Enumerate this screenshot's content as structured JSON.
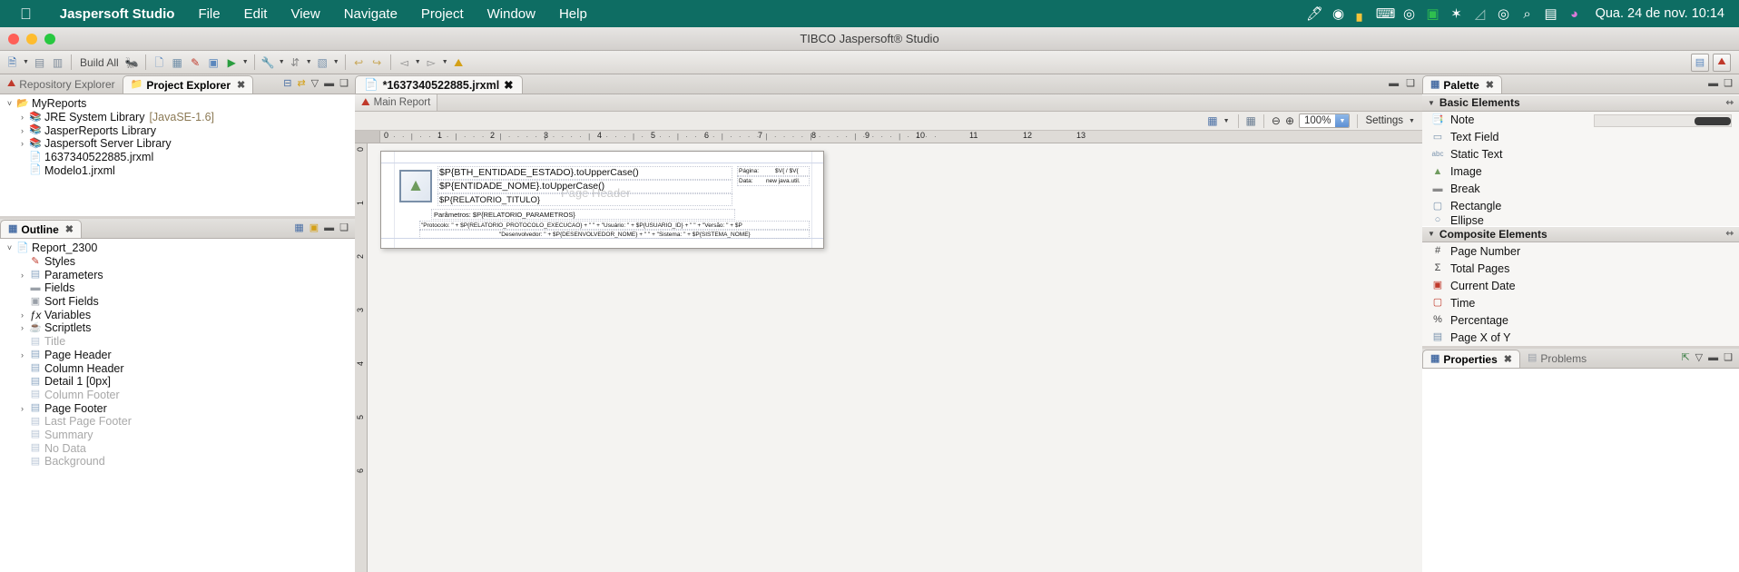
{
  "macmenu": {
    "apple": "",
    "items": [
      {
        "label": "Jaspersoft Studio",
        "bold": true
      },
      {
        "label": "File",
        "bold": false
      },
      {
        "label": "Edit",
        "bold": false
      },
      {
        "label": "View",
        "bold": false
      },
      {
        "label": "Navigate",
        "bold": false
      },
      {
        "label": "Project",
        "bold": false
      },
      {
        "label": "Window",
        "bold": false
      },
      {
        "label": "Help",
        "bold": false
      }
    ],
    "status_icons": [
      {
        "name": "feather-icon",
        "glyph": "🖋"
      },
      {
        "name": "dropbox-icon",
        "glyph": "◍"
      },
      {
        "name": "shield-yellow-icon",
        "glyph": "⬒"
      },
      {
        "name": "keyboard-icon",
        "glyph": "⌨"
      },
      {
        "name": "play-circle-icon",
        "glyph": "◉"
      },
      {
        "name": "brazil-flag-icon",
        "glyph": "▣"
      },
      {
        "name": "bluetooth-icon",
        "glyph": "✦"
      },
      {
        "name": "wifi-off-icon",
        "glyph": "◺"
      },
      {
        "name": "user-account-icon",
        "glyph": "◉"
      },
      {
        "name": "search-icon",
        "glyph": "⌕"
      },
      {
        "name": "display-icon",
        "glyph": "▤"
      },
      {
        "name": "siri-icon",
        "glyph": "◕"
      }
    ],
    "clock": "Qua. 24 de nov.  10:14"
  },
  "window": {
    "title": "TIBCO Jaspersoft® Studio"
  },
  "toolbar": {
    "build_label": "Build All",
    "buttons": [
      {
        "name": "new-wizard-button",
        "glyph": "🗋",
        "caret": true
      },
      {
        "name": "save-button",
        "glyph": "▤",
        "caret": false
      },
      {
        "name": "save-all-button",
        "glyph": "▥",
        "caret": false
      },
      {
        "name": "debug-button",
        "glyph": "🐞",
        "caret": false
      },
      {
        "name": "new-report-button",
        "glyph": "📄",
        "caret": false
      },
      {
        "name": "new-dataset-button",
        "glyph": "▦",
        "caret": false
      },
      {
        "name": "new-style-button",
        "glyph": "📝",
        "caret": false
      },
      {
        "name": "preview-button",
        "glyph": "📋",
        "caret": false
      },
      {
        "name": "run-button",
        "glyph": "▶",
        "caret": true
      },
      {
        "name": "external-tools-button",
        "glyph": "🔧",
        "caret": true
      },
      {
        "name": "sort-button",
        "glyph": "⇵",
        "caret": true
      },
      {
        "name": "compile-button",
        "glyph": "▧",
        "caret": true
      },
      {
        "name": "undo-button",
        "glyph": "↩",
        "caret": false
      },
      {
        "name": "redo-button",
        "glyph": "↪",
        "caret": false
      },
      {
        "name": "back-button",
        "glyph": "◅",
        "caret": true
      },
      {
        "name": "forward-button",
        "glyph": "▻",
        "caret": true
      },
      {
        "name": "jasper-button",
        "glyph": "⛰",
        "caret": false
      }
    ],
    "perspectives": [
      {
        "name": "perspective-report-design-button",
        "glyph": "▤"
      },
      {
        "name": "perspective-jasper-button",
        "glyph": "⛰"
      }
    ]
  },
  "project_explorer": {
    "tabs": [
      {
        "label": "Repository Explorer",
        "icon": "repository-icon",
        "active": false,
        "closable": false
      },
      {
        "label": "Project Explorer",
        "icon": "project-icon",
        "active": true,
        "closable": true
      }
    ],
    "tools": [
      {
        "name": "collapse-all-icon",
        "glyph": "⊟"
      },
      {
        "name": "link-with-editor-icon",
        "glyph": "⇄"
      },
      {
        "name": "view-menu-icon",
        "glyph": "▽"
      },
      {
        "name": "minimize-icon",
        "glyph": "▭"
      },
      {
        "name": "maximize-icon",
        "glyph": "❐"
      }
    ],
    "tree": [
      {
        "label": "MyReports",
        "indent": 1,
        "arrow": "expanded",
        "icon": "project-folder-icon",
        "glyph": "📂",
        "dim": false,
        "suffix": ""
      },
      {
        "label": "JRE System Library",
        "indent": 2,
        "arrow": "collapsed",
        "icon": "library-icon",
        "glyph": "📚",
        "dim": false,
        "suffix": "[JavaSE-1.6]"
      },
      {
        "label": "JasperReports Library",
        "indent": 2,
        "arrow": "collapsed",
        "icon": "library-icon",
        "glyph": "📚",
        "dim": false,
        "suffix": ""
      },
      {
        "label": "Jaspersoft Server Library",
        "indent": 2,
        "arrow": "collapsed",
        "icon": "library-icon",
        "glyph": "📚",
        "dim": false,
        "suffix": ""
      },
      {
        "label": "1637340522885.jrxml",
        "indent": 2,
        "arrow": "none",
        "icon": "jrxml-file-icon",
        "glyph": "📄",
        "dim": false,
        "suffix": ""
      },
      {
        "label": "Modelo1.jrxml",
        "indent": 2,
        "arrow": "none",
        "icon": "jrxml-file-icon",
        "glyph": "📄",
        "dim": false,
        "suffix": ""
      }
    ]
  },
  "outline": {
    "tabs": [
      {
        "label": "Outline",
        "icon": "outline-icon",
        "active": true,
        "closable": true
      }
    ],
    "tools": [
      {
        "name": "outline-layout-icon",
        "glyph": "▦"
      },
      {
        "name": "outline-filter-icon",
        "glyph": "▣"
      },
      {
        "name": "minimize-icon",
        "glyph": "▭"
      },
      {
        "name": "maximize-icon",
        "glyph": "❐"
      }
    ],
    "tree": [
      {
        "label": "Report_2300",
        "indent": 1,
        "arrow": "expanded",
        "icon": "report-icon",
        "glyph": "📄",
        "dim": false
      },
      {
        "label": "Styles",
        "indent": 2,
        "arrow": "none",
        "icon": "styles-pencil-icon",
        "glyph": "🖉",
        "dim": false
      },
      {
        "label": "Parameters",
        "indent": 2,
        "arrow": "collapsed",
        "icon": "parameters-icon",
        "glyph": "▤",
        "dim": false
      },
      {
        "label": "Fields",
        "indent": 2,
        "arrow": "none",
        "icon": "fields-icon",
        "glyph": "▭",
        "dim": false
      },
      {
        "label": "Sort Fields",
        "indent": 2,
        "arrow": "none",
        "icon": "sort-fields-icon",
        "glyph": "▣",
        "dim": false
      },
      {
        "label": "Variables",
        "indent": 2,
        "arrow": "collapsed",
        "icon": "variables-fx-icon",
        "glyph": "𝑓𝑥",
        "dim": false
      },
      {
        "label": "Scriptlets",
        "indent": 2,
        "arrow": "collapsed",
        "icon": "scriptlets-coffee-icon",
        "glyph": "☕",
        "dim": false
      },
      {
        "label": "Title",
        "indent": 2,
        "arrow": "none",
        "icon": "band-icon",
        "glyph": "▤",
        "dim": true
      },
      {
        "label": "Page Header",
        "indent": 2,
        "arrow": "collapsed",
        "icon": "band-icon",
        "glyph": "▤",
        "dim": false
      },
      {
        "label": "Column Header",
        "indent": 2,
        "arrow": "none",
        "icon": "band-icon",
        "glyph": "▤",
        "dim": false
      },
      {
        "label": "Detail 1 [0px]",
        "indent": 2,
        "arrow": "none",
        "icon": "band-icon",
        "glyph": "▤",
        "dim": false
      },
      {
        "label": "Column Footer",
        "indent": 2,
        "arrow": "none",
        "icon": "band-icon",
        "glyph": "▤",
        "dim": true
      },
      {
        "label": "Page Footer",
        "indent": 2,
        "arrow": "collapsed",
        "icon": "band-icon",
        "glyph": "▤",
        "dim": false
      },
      {
        "label": "Last Page Footer",
        "indent": 2,
        "arrow": "none",
        "icon": "band-icon",
        "glyph": "▤",
        "dim": true
      },
      {
        "label": "Summary",
        "indent": 2,
        "arrow": "none",
        "icon": "band-icon",
        "glyph": "▤",
        "dim": true
      },
      {
        "label": "No Data",
        "indent": 2,
        "arrow": "none",
        "icon": "band-icon",
        "glyph": "▤",
        "dim": true
      },
      {
        "label": "Background",
        "indent": 2,
        "arrow": "none",
        "icon": "band-icon",
        "glyph": "▤",
        "dim": true
      }
    ]
  },
  "editor": {
    "tab_label": "*1637340522885.jrxml",
    "tab_icon": "jrxml-file-icon",
    "tools": [
      {
        "name": "minimize-icon",
        "glyph": "▭"
      },
      {
        "name": "maximize-icon",
        "glyph": "❐"
      }
    ],
    "subtabs": [
      {
        "label": "Main Report",
        "icon": "main-report-icon"
      }
    ],
    "zoombar": {
      "fit_page_label": "⛶",
      "grid_label": "▦",
      "zoom_out_label": "⊖",
      "zoom_in_label": "⊕",
      "zoom_value": "100%",
      "settings_label": "Settings",
      "menu_label": "▽"
    },
    "ruler": {
      "h_ticks": [
        "0",
        "1",
        "2",
        "3",
        "4",
        "5",
        "6",
        "7",
        "8",
        "9",
        "10",
        "11",
        "12",
        "13"
      ],
      "v_ticks": [
        "0",
        "1",
        "2",
        "3",
        "4",
        "5",
        "6"
      ]
    },
    "canvas": {
      "band_label": "Page Header",
      "elements": [
        {
          "name": "report-logo",
          "text": "",
          "type": "image"
        },
        {
          "name": "entidade-estado-expr",
          "text": "$P{BTH_ENTIDADE_ESTADO}.toUpperCase()",
          "size": "normal"
        },
        {
          "name": "entidade-nome-expr",
          "text": "$P{ENTIDADE_NOME}.toUpperCase()",
          "size": "normal"
        },
        {
          "name": "relatorio-titulo-expr",
          "text": "$P{RELATORIO_TITULO}",
          "size": "normal"
        },
        {
          "name": "parametros-expr",
          "text": "Parâmetros:  $P{RELATORIO_PARAMETROS}",
          "size": "small"
        },
        {
          "name": "protocolo-expr",
          "text": "\"Protocolo: \" + $P{RELATORIO_PROTOCOLO_EXECUCAO} + \"   \" + \"Usuário: \" + $P{USUARIO_ID} + \"   \" + \"Versão: \" + $P",
          "size": "tiny"
        },
        {
          "name": "desenvolvedor-expr",
          "text": "\"Desenvolvedor: \" + $P{DESENVOLVEDOR_NOME} + \"   \" + \"Sistema: \" + $P{SISTEMA_NOME}",
          "size": "tiny"
        },
        {
          "name": "pagina-label",
          "text": "Página:",
          "size": "tiny"
        },
        {
          "name": "pagina-value",
          "text": "$V{ /  $V{",
          "size": "tiny"
        },
        {
          "name": "data-label",
          "text": "Data:",
          "size": "tiny"
        },
        {
          "name": "data-value",
          "text": "new java.util.",
          "size": "tiny"
        }
      ]
    }
  },
  "palette": {
    "tabs": [
      {
        "label": "Palette",
        "icon": "palette-icon",
        "active": true,
        "closable": true
      }
    ],
    "tools": [
      {
        "name": "minimize-icon",
        "glyph": "▭"
      },
      {
        "name": "maximize-icon",
        "glyph": "❐"
      }
    ],
    "groups": [
      {
        "title": "Basic Elements",
        "name": "palette-group-basic-elements",
        "items": [
          {
            "label": "Note",
            "icon": "note-icon",
            "glyph": "🗒"
          },
          {
            "label": "Text Field",
            "icon": "text-field-icon",
            "glyph": "▭"
          },
          {
            "label": "Static Text",
            "icon": "static-text-icon",
            "glyph": "abc"
          },
          {
            "label": "Image",
            "icon": "image-icon",
            "glyph": "🖼"
          },
          {
            "label": "Break",
            "icon": "break-icon",
            "glyph": "▬"
          },
          {
            "label": "Rectangle",
            "icon": "rectangle-icon",
            "glyph": "▢"
          },
          {
            "label": "Ellipse",
            "icon": "ellipse-icon",
            "glyph": "◯"
          }
        ]
      },
      {
        "title": "Composite Elements",
        "name": "palette-group-composite-elements",
        "items": [
          {
            "label": "Page Number",
            "icon": "page-number-icon",
            "glyph": "#"
          },
          {
            "label": "Total Pages",
            "icon": "total-pages-icon",
            "glyph": "Σ"
          },
          {
            "label": "Current Date",
            "icon": "current-date-icon",
            "glyph": "📅"
          },
          {
            "label": "Time",
            "icon": "time-icon",
            "glyph": "🕐"
          },
          {
            "label": "Percentage",
            "icon": "percentage-icon",
            "glyph": "%"
          },
          {
            "label": "Page X of Y",
            "icon": "page-x-of-y-icon",
            "glyph": "▤"
          }
        ]
      }
    ]
  },
  "properties": {
    "tabs": [
      {
        "label": "Properties",
        "icon": "properties-icon",
        "active": true,
        "closable": true
      },
      {
        "label": "Problems",
        "icon": "problems-icon",
        "active": false,
        "closable": false
      }
    ],
    "tools": [
      {
        "name": "new-window-icon",
        "glyph": "⇱"
      },
      {
        "name": "view-menu-icon",
        "glyph": "▽"
      },
      {
        "name": "minimize-icon",
        "glyph": "▭"
      },
      {
        "name": "maximize-icon",
        "glyph": "❐"
      }
    ]
  }
}
